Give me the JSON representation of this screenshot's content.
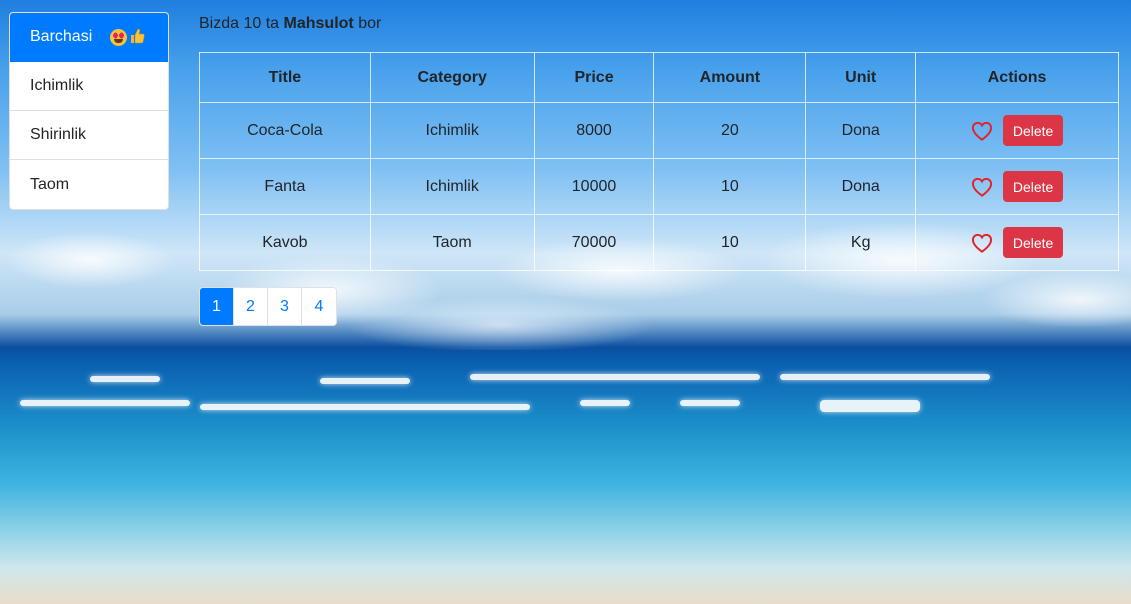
{
  "sidebar": {
    "items": [
      {
        "label": "Barchasi",
        "active": true,
        "emojis": [
          "star-struck-emoji",
          "thumbs-up-emoji"
        ]
      },
      {
        "label": "Ichimlik",
        "active": false
      },
      {
        "label": "Shirinlik",
        "active": false
      },
      {
        "label": "Taom",
        "active": false
      }
    ]
  },
  "info": {
    "prefix": "Bizda 10 ta",
    "highlight": "Mahsulot",
    "suffix": "bor"
  },
  "table": {
    "headers": {
      "title": "Title",
      "category": "Category",
      "price": "Price",
      "amount": "Amount",
      "unit": "Unit",
      "actions": "Actions"
    },
    "rows": [
      {
        "title": "Coca-Cola",
        "category": "Ichimlik",
        "price": "8000",
        "amount": "20",
        "unit": "Dona",
        "delete_label": "Delete"
      },
      {
        "title": "Fanta",
        "category": "Ichimlik",
        "price": "10000",
        "amount": "10",
        "unit": "Dona",
        "delete_label": "Delete"
      },
      {
        "title": "Kavob",
        "category": "Taom",
        "price": "70000",
        "amount": "10",
        "unit": "Kg",
        "delete_label": "Delete"
      }
    ]
  },
  "pagination": {
    "pages": [
      "1",
      "2",
      "3",
      "4"
    ],
    "active": "1"
  },
  "colors": {
    "primary": "#007bff",
    "danger": "#dc3545",
    "heart": "#e3242b"
  }
}
